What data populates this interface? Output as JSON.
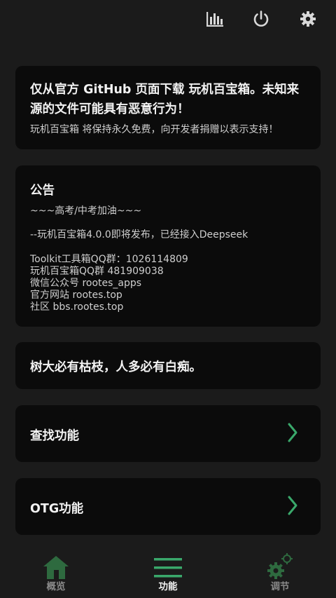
{
  "colors": {
    "background": "#1b1b1b",
    "card": "#0b0b0b",
    "accent_green": "#3aa86b",
    "inactive_green": "#2e6a3f"
  },
  "topbar": {
    "icons": [
      "chart-icon",
      "power-icon",
      "gear-icon"
    ]
  },
  "warning_card": {
    "title": "仅从官方 GitHub 页面下载 玩机百宝箱。未知来源的文件可能具有恶意行为！",
    "subtitle": "玩机百宝箱 将保持永久免费，向开发者捐赠以表示支持！"
  },
  "notice_card": {
    "title": "公告",
    "lines": [
      "~~~高考/中考加油~~~",
      "--玩机百宝箱4.0.0即将发布，已经接入Deepseek",
      "Toolkit工具箱QQ群：1026114809",
      "玩机百宝箱QQ群 481909038",
      "微信公众号 rootes_apps",
      "官方网站 rootes.top",
      "社区 bbs.rootes.top"
    ]
  },
  "quote_card": {
    "text": "树大必有枯枝，人多必有白痴。"
  },
  "menu": [
    {
      "label": "查找功能",
      "icon": "chevron-right-icon"
    },
    {
      "label": "OTG功能",
      "icon": "chevron-right-icon"
    }
  ],
  "bottom_nav": {
    "tabs": [
      {
        "label": "概览",
        "icon": "home-icon",
        "active": false
      },
      {
        "label": "功能",
        "icon": "menu-icon",
        "active": true
      },
      {
        "label": "调节",
        "icon": "gears-icon",
        "active": false
      }
    ]
  }
}
